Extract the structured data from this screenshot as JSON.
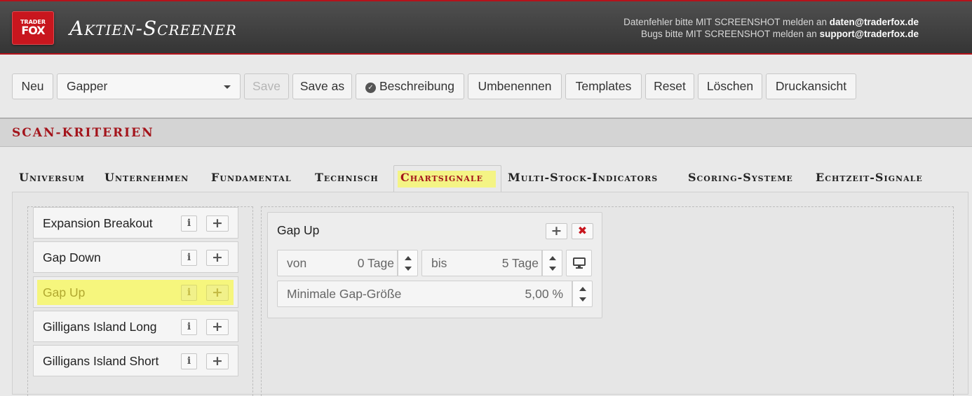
{
  "header": {
    "logo_line1": "TRADER",
    "logo_line2": "FOX",
    "title": "Aktien-Screener",
    "contact_line1_prefix": "Datenfehler bitte MIT SCREENSHOT melden an ",
    "contact_line1_email": "daten@traderfox.de",
    "contact_line2_prefix": "Bugs bitte MIT SCREENSHOT melden an ",
    "contact_line2_email": "support@traderfox.de"
  },
  "toolbar": {
    "new_label": "Neu",
    "scan_select_value": "Gapper",
    "save_label": "Save",
    "save_as_label": "Save as",
    "description_label": "Beschreibung",
    "rename_label": "Umbenennen",
    "templates_label": "Templates",
    "reset_label": "Reset",
    "delete_label": "Löschen",
    "print_label": "Druckansicht"
  },
  "section": {
    "title": "SCAN-KRITERIEN"
  },
  "tabs": [
    {
      "label": "Universum",
      "active": false
    },
    {
      "label": "Unternehmen",
      "active": false
    },
    {
      "label": "Fundamental",
      "active": false
    },
    {
      "label": "Technisch",
      "active": false
    },
    {
      "label": "Chartsignale",
      "active": true
    },
    {
      "label": "Multi-Stock-Indicators",
      "active": false
    },
    {
      "label": "Scoring-Systeme",
      "active": false
    },
    {
      "label": "Echtzeit-Signale",
      "active": false
    }
  ],
  "signal_list": {
    "info_glyph": "i",
    "add_glyph": "+",
    "items": [
      {
        "label": "Expansion Breakout",
        "highlighted": false
      },
      {
        "label": "Gap Down",
        "highlighted": false
      },
      {
        "label": "Gap Up",
        "highlighted": true
      },
      {
        "label": "Gilligans Island Long",
        "highlighted": false
      },
      {
        "label": "Gilligans Island Short",
        "highlighted": false
      }
    ]
  },
  "criterion": {
    "title": "Gap Up",
    "add_glyph": "+",
    "remove_glyph": "✖",
    "from_label": "von",
    "from_value": "0 Tage",
    "to_label": "bis",
    "to_value": "5 Tage",
    "min_gap_label": "Minimale Gap-Größe",
    "min_gap_value": "5,00 %"
  },
  "colors": {
    "brand_red": "#c8161e",
    "highlight_yellow": "#f6f67d",
    "header_dark": "#3f3f3f"
  },
  "icons": {
    "select_caret": "chevron-down-icon",
    "description": "check-circle-icon",
    "monitor": "monitor-icon",
    "spinner": "spinner-arrows-icon"
  }
}
